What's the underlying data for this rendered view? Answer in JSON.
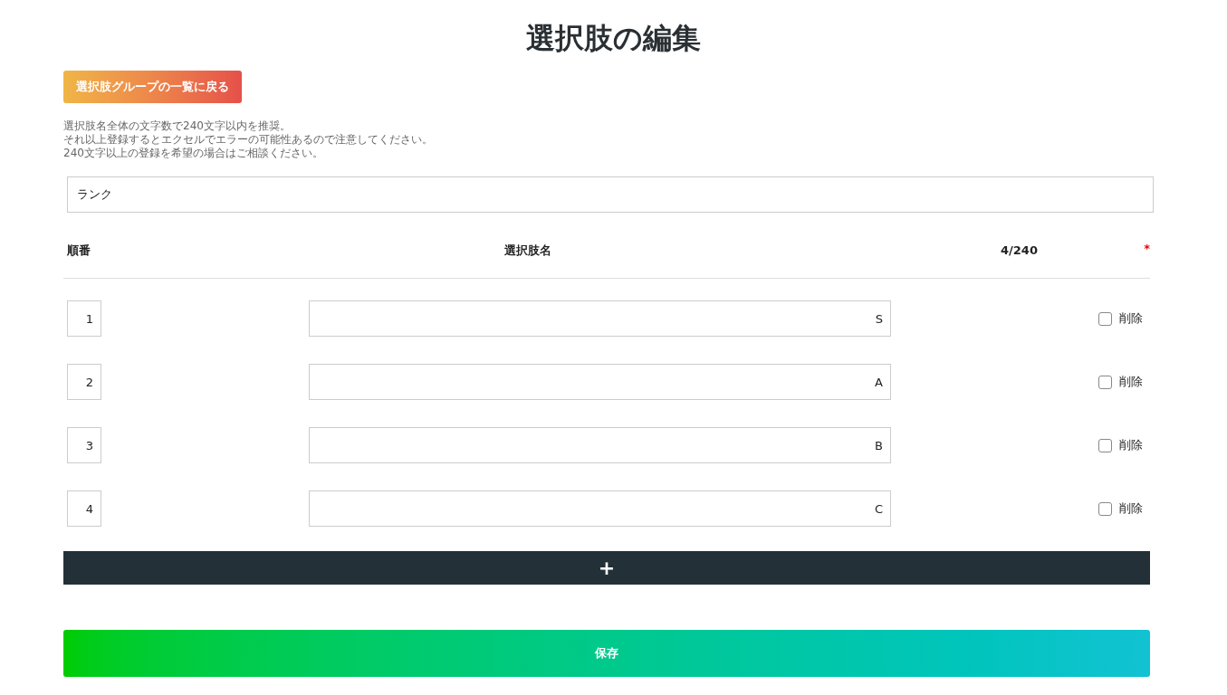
{
  "title": "選択肢の編集",
  "back_button": "選択肢グループの一覧に戻る",
  "notes": [
    "選択肢名全体の文字数で240文字以内を推奨。",
    "それ以上登録するとエクセルでエラーの可能性あるので注意してください。",
    "240文字以上の登録を希望の場合はご相談ください。"
  ],
  "group_name": {
    "value": "ランク"
  },
  "columns": {
    "order": "順番",
    "name": "選択肢名",
    "count": "4/240",
    "required_mark": "*"
  },
  "rows": [
    {
      "order": "1",
      "name": "S",
      "delete_label": "削除",
      "checked": false
    },
    {
      "order": "2",
      "name": "A",
      "delete_label": "削除",
      "checked": false
    },
    {
      "order": "3",
      "name": "B",
      "delete_label": "削除",
      "checked": false
    },
    {
      "order": "4",
      "name": "C",
      "delete_label": "削除",
      "checked": false
    }
  ],
  "add_button": "+",
  "save_button": "保存"
}
